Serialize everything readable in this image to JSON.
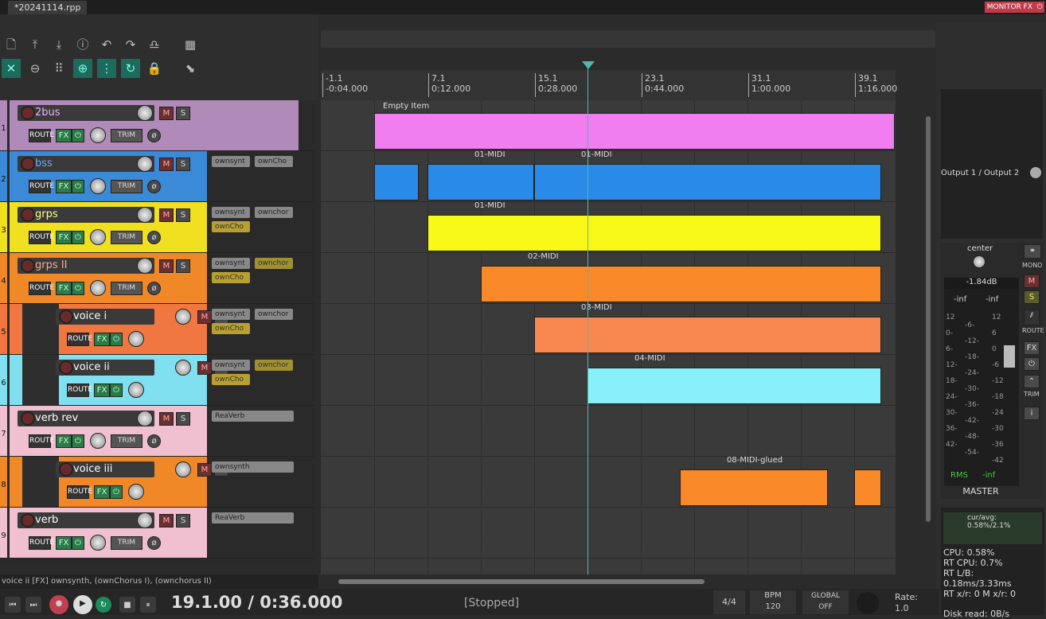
{
  "window": {
    "tab": "*20241114.rpp",
    "monitor_fx": "MONITOR FX"
  },
  "ruler": [
    {
      "bar": "-1.1",
      "time": "-0:04.000"
    },
    {
      "bar": "7.1",
      "time": "0:12.000"
    },
    {
      "bar": "15.1",
      "time": "0:28.000"
    },
    {
      "bar": "23.1",
      "time": "0:44.000"
    },
    {
      "bar": "31.1",
      "time": "1:00.000"
    },
    {
      "bar": "39.1",
      "time": "1:16.000"
    }
  ],
  "tracks": [
    {
      "num": "1",
      "name": "2bus",
      "color": "#b08ab8",
      "namecolor": "#e8b8f8",
      "fx": []
    },
    {
      "num": "2",
      "name": "bss",
      "color": "#3a8ad8",
      "namecolor": "#6af",
      "fx": [
        "ownsynt",
        "ownCho"
      ]
    },
    {
      "num": "3",
      "name": "grps",
      "color": "#f0e020",
      "namecolor": "#ff8",
      "fx": [
        "ownsynt",
        "ownchor",
        "ownCho"
      ]
    },
    {
      "num": "4",
      "name": "grps II",
      "color": "#f08828",
      "namecolor": "#fa8",
      "fx": [
        "ownsynt",
        "ownchor",
        "ownCho"
      ]
    },
    {
      "num": "5",
      "name": "voice i",
      "color": "#f07840",
      "namecolor": "#fff",
      "fx": [
        "ownsynt",
        "ownchor",
        "ownCho"
      ]
    },
    {
      "num": "6",
      "name": "voice ii",
      "color": "#80e0f0",
      "namecolor": "#fff",
      "fx": [
        "ownsynt",
        "ownchor",
        "ownCho"
      ]
    },
    {
      "num": "7",
      "name": "verb rev",
      "color": "#f0c0d0",
      "namecolor": "#fff",
      "fx": [
        "ReaVerb"
      ]
    },
    {
      "num": "8",
      "name": "voice iii",
      "color": "#f08828",
      "namecolor": "#fff",
      "fx": [
        "ownsynth"
      ]
    },
    {
      "num": "9",
      "name": "verb",
      "color": "#f0c0d0",
      "namecolor": "#fff",
      "fx": [
        "ReaVerb"
      ]
    }
  ],
  "buttons": {
    "route": "ROUTE",
    "fx": "FX",
    "trim": "TRIM",
    "m": "M",
    "s": "S"
  },
  "items": {
    "empty": "Empty Item",
    "midi01": "01-MIDI",
    "midi02": "02-MIDI",
    "midi03": "03-MIDI",
    "midi04": "04-MIDI",
    "midi08": "08-MIDI-glued"
  },
  "master": {
    "output": "Output 1 / Output 2",
    "pan": "center",
    "db": "-1.84dB",
    "peakL": "-inf",
    "peakR": "-inf",
    "rms": "RMS",
    "rmsval": "-inf",
    "label": "MASTER",
    "mono": "MONO",
    "route": "ROUTE",
    "fx": "FX",
    "trim": "TRIM",
    "m": "M",
    "s": "S",
    "scaleL": [
      "12",
      "0-",
      "6-",
      "12-",
      "18-",
      "24-",
      "30-",
      "36-",
      "42-"
    ],
    "scaleM": [
      "-6-",
      "-12-",
      "-18-",
      "-24-",
      "-30-",
      "-36-",
      "-42-",
      "-48-",
      "-54-"
    ],
    "scaleR": [
      "12",
      "6",
      "0",
      "-6",
      "-12",
      "-18",
      "-24",
      "-30",
      "-36",
      "-42"
    ]
  },
  "perf": {
    "curavg": "cur/avg: 0.58%/2.1%",
    "cpu": "CPU: 0.58%",
    "rtcpu": "RT CPU: 0.7%",
    "rtlb": "RT L/B: 0.18ms/3.33ms",
    "rtxr": "RT x/r: 0 M x/r: 0",
    "disk": "Disk read: 0B/s"
  },
  "status": "voice ii [FX] ownsynth, (ownChorus I), (ownchorus II)",
  "transport": {
    "time": "19.1.00 / 0:36.000",
    "state": "[Stopped]",
    "ts": "4/4",
    "bpm_label": "BPM",
    "bpm": "120",
    "global": "GLOBAL",
    "off": "OFF",
    "rate_label": "Rate:",
    "rate": "1.0"
  }
}
